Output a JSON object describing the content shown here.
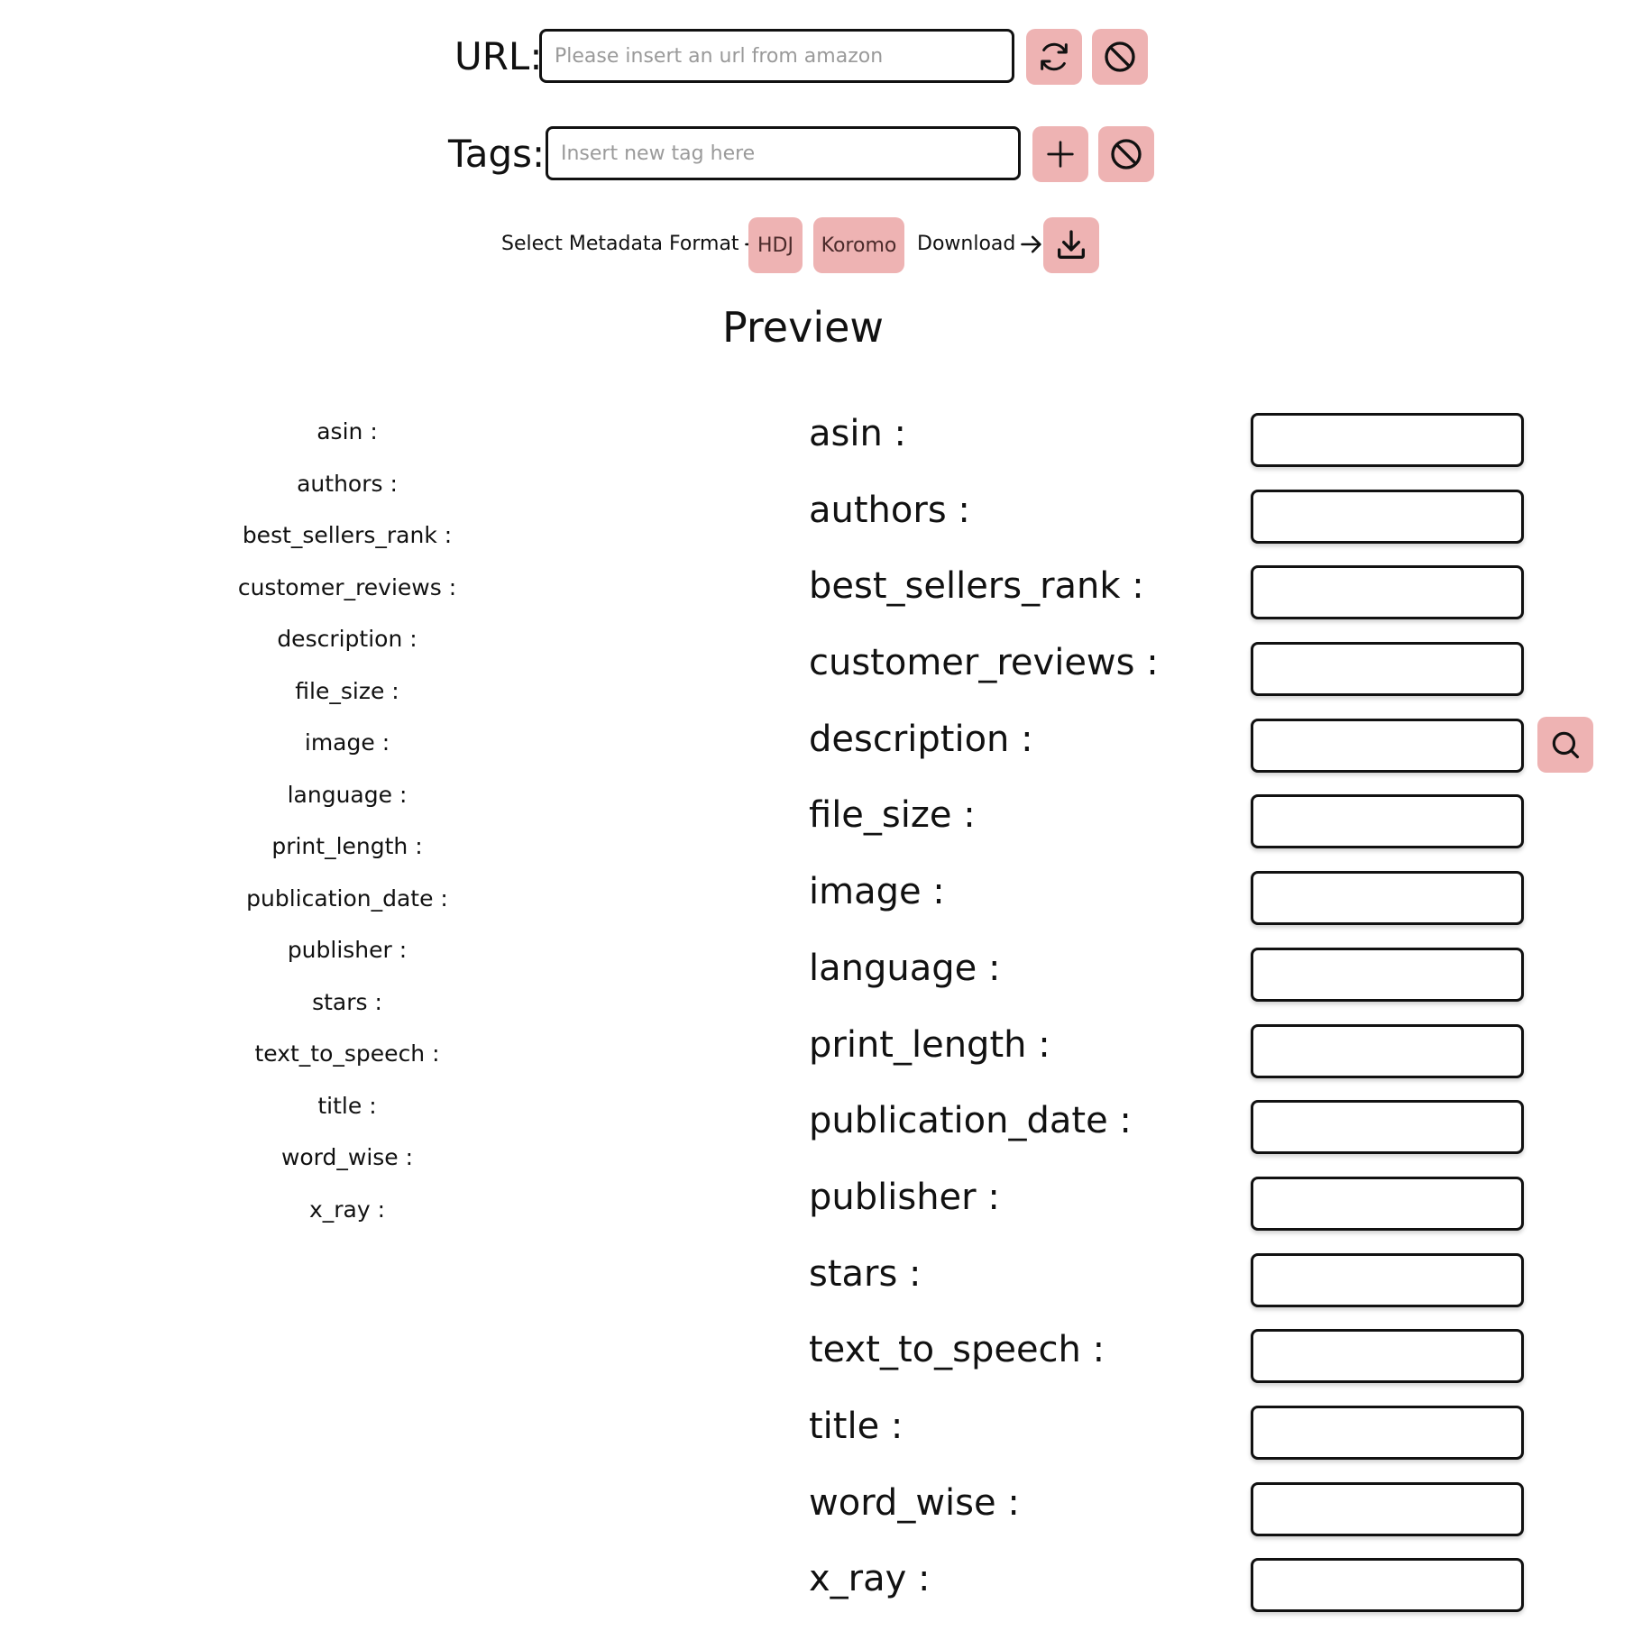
{
  "url_row": {
    "label": "URL:",
    "placeholder": "Please insert an url from amazon",
    "value": "",
    "refresh_icon": "refresh-icon",
    "clear_icon": "ban-icon"
  },
  "tags_row": {
    "label": "Tags:",
    "placeholder": "Insert new tag here",
    "value": "",
    "add_icon": "plus-icon",
    "clear_icon": "ban-icon"
  },
  "format_row": {
    "select_label": "Select Metadata Format",
    "formats": [
      "HDJ",
      "Koromo"
    ],
    "download_label": "Download",
    "download_icon": "download-icon",
    "arrow_icon": "arrow-right-icon"
  },
  "preview": {
    "title": "Preview",
    "fields": [
      {
        "label": "asin :",
        "value": ""
      },
      {
        "label": "authors :",
        "value": ""
      },
      {
        "label": "best_sellers_rank :",
        "value": ""
      },
      {
        "label": "customer_reviews :",
        "value": ""
      },
      {
        "label": "description :",
        "value": "",
        "has_search": true
      },
      {
        "label": "file_size :",
        "value": ""
      },
      {
        "label": "image :",
        "value": ""
      },
      {
        "label": "language :",
        "value": ""
      },
      {
        "label": "print_length :",
        "value": ""
      },
      {
        "label": "publication_date :",
        "value": ""
      },
      {
        "label": "publisher :",
        "value": ""
      },
      {
        "label": "stars :",
        "value": ""
      },
      {
        "label": "text_to_speech :",
        "value": ""
      },
      {
        "label": "title :",
        "value": ""
      },
      {
        "label": "word_wise :",
        "value": ""
      },
      {
        "label": "x_ray :",
        "value": ""
      }
    ],
    "search_icon": "search-icon"
  },
  "colors": {
    "button_bg": "#eeb3b3",
    "border": "#111111",
    "placeholder": "#9a9a9a"
  }
}
